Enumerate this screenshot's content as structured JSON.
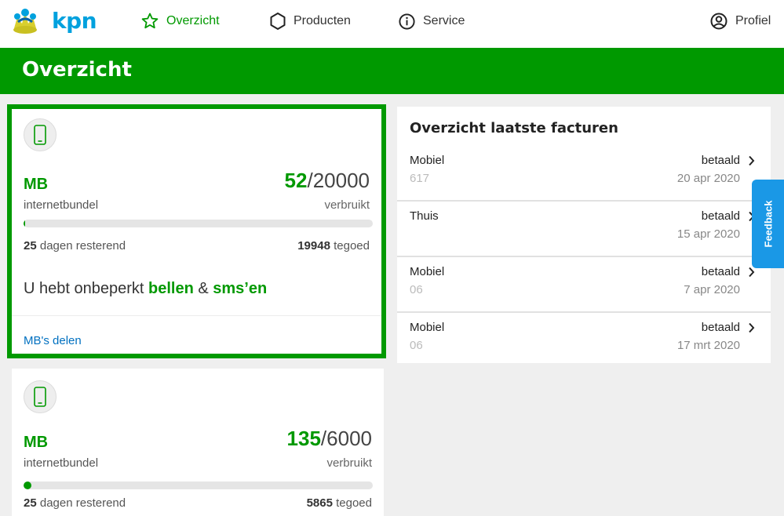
{
  "brand": {
    "logo_text": "kpn",
    "green": "#009900",
    "blue": "#00a1de"
  },
  "nav": {
    "items": [
      {
        "label": "Overzicht",
        "icon": "star-icon",
        "active": true
      },
      {
        "label": "Producten",
        "icon": "hexagon-icon",
        "active": false
      },
      {
        "label": "Service",
        "icon": "info-icon",
        "active": false
      }
    ],
    "profile": {
      "label": "Profiel",
      "icon": "user-circle-icon"
    }
  },
  "page": {
    "title": "Overzicht"
  },
  "bundles": [
    {
      "icon": "phone-icon",
      "unit": "MB",
      "used": "52",
      "total": "/20000",
      "type_label": "internetbundel",
      "used_label": "verbruikt",
      "usage_fraction": 0.0026,
      "days_left": "25",
      "days_label": "dagen resterend",
      "remaining": "19948",
      "remaining_label": "tegoed",
      "unlimited_prefix": "U hebt onbeperkt",
      "unlimited_calls": "bellen",
      "unlimited_and": "&",
      "unlimited_sms": "sms’en",
      "share_link": "MB's delen"
    },
    {
      "icon": "phone-icon",
      "unit": "MB",
      "used": "135",
      "total": "/6000",
      "type_label": "internetbundel",
      "used_label": "verbruikt",
      "usage_fraction": 0.0225,
      "days_left": "25",
      "days_label": "dagen resterend",
      "remaining": "5865",
      "remaining_label": "tegoed"
    }
  ],
  "invoices": {
    "title": "Overzicht laatste facturen",
    "rows": [
      {
        "name": "Mobiel",
        "sub": "617",
        "status": "betaald",
        "date": "20 apr 2020"
      },
      {
        "name": "Thuis",
        "sub": "",
        "status": "betaald",
        "date": "15 apr 2020"
      },
      {
        "name": "Mobiel",
        "sub": "06",
        "status": "betaald",
        "date": "7 apr 2020"
      },
      {
        "name": "Mobiel",
        "sub": "06",
        "status": "betaald",
        "date": "17 mrt 2020"
      }
    ]
  },
  "feedback": {
    "label": "Feedback"
  }
}
